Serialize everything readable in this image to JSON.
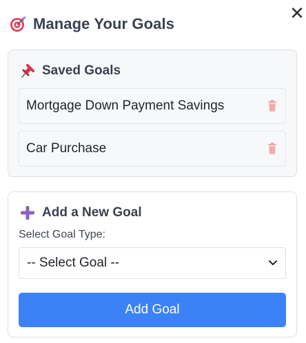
{
  "header": {
    "title": "Manage Your Goals",
    "icon": "target-icon",
    "close_symbol": "✕"
  },
  "saved": {
    "title": "Saved Goals",
    "icon": "pushpin-icon",
    "goals": [
      {
        "name": "Mortgage Down Payment Savings",
        "delete_icon": "trash-icon"
      },
      {
        "name": "Car Purchase",
        "delete_icon": "trash-icon"
      }
    ]
  },
  "add": {
    "title": "Add a New Goal",
    "icon": "plus-icon",
    "type_label": "Select Goal Type:",
    "select_value": "-- Select Goal --",
    "button_label": "Add Goal"
  },
  "colors": {
    "accent": "#3b82f6",
    "plus": "#8a63c6",
    "trash": "#f0a0a0",
    "pin": "#d8344c"
  }
}
